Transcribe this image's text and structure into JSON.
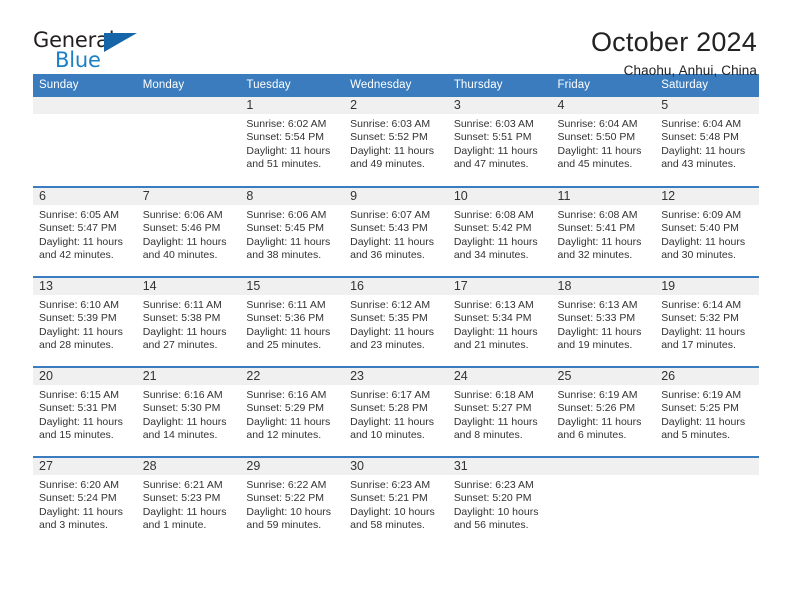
{
  "brand": {
    "name_top": "General",
    "name_bottom": "Blue",
    "triangle_color": "#1565a8",
    "blue_text_color": "#1c7fc4"
  },
  "header": {
    "title": "October 2024",
    "subtitle": "Chaohu, Anhui, China",
    "accent_color": "#3a7cbe",
    "daynum_band_color": "#f0f0f0"
  },
  "weekdays": [
    "Sunday",
    "Monday",
    "Tuesday",
    "Wednesday",
    "Thursday",
    "Friday",
    "Saturday"
  ],
  "weeks": [
    [
      {
        "day": "",
        "lines": []
      },
      {
        "day": "",
        "lines": []
      },
      {
        "day": "1",
        "lines": [
          "Sunrise: 6:02 AM",
          "Sunset: 5:54 PM",
          "Daylight: 11 hours",
          "and 51 minutes."
        ]
      },
      {
        "day": "2",
        "lines": [
          "Sunrise: 6:03 AM",
          "Sunset: 5:52 PM",
          "Daylight: 11 hours",
          "and 49 minutes."
        ]
      },
      {
        "day": "3",
        "lines": [
          "Sunrise: 6:03 AM",
          "Sunset: 5:51 PM",
          "Daylight: 11 hours",
          "and 47 minutes."
        ]
      },
      {
        "day": "4",
        "lines": [
          "Sunrise: 6:04 AM",
          "Sunset: 5:50 PM",
          "Daylight: 11 hours",
          "and 45 minutes."
        ]
      },
      {
        "day": "5",
        "lines": [
          "Sunrise: 6:04 AM",
          "Sunset: 5:48 PM",
          "Daylight: 11 hours",
          "and 43 minutes."
        ]
      }
    ],
    [
      {
        "day": "6",
        "lines": [
          "Sunrise: 6:05 AM",
          "Sunset: 5:47 PM",
          "Daylight: 11 hours",
          "and 42 minutes."
        ]
      },
      {
        "day": "7",
        "lines": [
          "Sunrise: 6:06 AM",
          "Sunset: 5:46 PM",
          "Daylight: 11 hours",
          "and 40 minutes."
        ]
      },
      {
        "day": "8",
        "lines": [
          "Sunrise: 6:06 AM",
          "Sunset: 5:45 PM",
          "Daylight: 11 hours",
          "and 38 minutes."
        ]
      },
      {
        "day": "9",
        "lines": [
          "Sunrise: 6:07 AM",
          "Sunset: 5:43 PM",
          "Daylight: 11 hours",
          "and 36 minutes."
        ]
      },
      {
        "day": "10",
        "lines": [
          "Sunrise: 6:08 AM",
          "Sunset: 5:42 PM",
          "Daylight: 11 hours",
          "and 34 minutes."
        ]
      },
      {
        "day": "11",
        "lines": [
          "Sunrise: 6:08 AM",
          "Sunset: 5:41 PM",
          "Daylight: 11 hours",
          "and 32 minutes."
        ]
      },
      {
        "day": "12",
        "lines": [
          "Sunrise: 6:09 AM",
          "Sunset: 5:40 PM",
          "Daylight: 11 hours",
          "and 30 minutes."
        ]
      }
    ],
    [
      {
        "day": "13",
        "lines": [
          "Sunrise: 6:10 AM",
          "Sunset: 5:39 PM",
          "Daylight: 11 hours",
          "and 28 minutes."
        ]
      },
      {
        "day": "14",
        "lines": [
          "Sunrise: 6:11 AM",
          "Sunset: 5:38 PM",
          "Daylight: 11 hours",
          "and 27 minutes."
        ]
      },
      {
        "day": "15",
        "lines": [
          "Sunrise: 6:11 AM",
          "Sunset: 5:36 PM",
          "Daylight: 11 hours",
          "and 25 minutes."
        ]
      },
      {
        "day": "16",
        "lines": [
          "Sunrise: 6:12 AM",
          "Sunset: 5:35 PM",
          "Daylight: 11 hours",
          "and 23 minutes."
        ]
      },
      {
        "day": "17",
        "lines": [
          "Sunrise: 6:13 AM",
          "Sunset: 5:34 PM",
          "Daylight: 11 hours",
          "and 21 minutes."
        ]
      },
      {
        "day": "18",
        "lines": [
          "Sunrise: 6:13 AM",
          "Sunset: 5:33 PM",
          "Daylight: 11 hours",
          "and 19 minutes."
        ]
      },
      {
        "day": "19",
        "lines": [
          "Sunrise: 6:14 AM",
          "Sunset: 5:32 PM",
          "Daylight: 11 hours",
          "and 17 minutes."
        ]
      }
    ],
    [
      {
        "day": "20",
        "lines": [
          "Sunrise: 6:15 AM",
          "Sunset: 5:31 PM",
          "Daylight: 11 hours",
          "and 15 minutes."
        ]
      },
      {
        "day": "21",
        "lines": [
          "Sunrise: 6:16 AM",
          "Sunset: 5:30 PM",
          "Daylight: 11 hours",
          "and 14 minutes."
        ]
      },
      {
        "day": "22",
        "lines": [
          "Sunrise: 6:16 AM",
          "Sunset: 5:29 PM",
          "Daylight: 11 hours",
          "and 12 minutes."
        ]
      },
      {
        "day": "23",
        "lines": [
          "Sunrise: 6:17 AM",
          "Sunset: 5:28 PM",
          "Daylight: 11 hours",
          "and 10 minutes."
        ]
      },
      {
        "day": "24",
        "lines": [
          "Sunrise: 6:18 AM",
          "Sunset: 5:27 PM",
          "Daylight: 11 hours",
          "and 8 minutes."
        ]
      },
      {
        "day": "25",
        "lines": [
          "Sunrise: 6:19 AM",
          "Sunset: 5:26 PM",
          "Daylight: 11 hours",
          "and 6 minutes."
        ]
      },
      {
        "day": "26",
        "lines": [
          "Sunrise: 6:19 AM",
          "Sunset: 5:25 PM",
          "Daylight: 11 hours",
          "and 5 minutes."
        ]
      }
    ],
    [
      {
        "day": "27",
        "lines": [
          "Sunrise: 6:20 AM",
          "Sunset: 5:24 PM",
          "Daylight: 11 hours",
          "and 3 minutes."
        ]
      },
      {
        "day": "28",
        "lines": [
          "Sunrise: 6:21 AM",
          "Sunset: 5:23 PM",
          "Daylight: 11 hours",
          "and 1 minute."
        ]
      },
      {
        "day": "29",
        "lines": [
          "Sunrise: 6:22 AM",
          "Sunset: 5:22 PM",
          "Daylight: 10 hours",
          "and 59 minutes."
        ]
      },
      {
        "day": "30",
        "lines": [
          "Sunrise: 6:23 AM",
          "Sunset: 5:21 PM",
          "Daylight: 10 hours",
          "and 58 minutes."
        ]
      },
      {
        "day": "31",
        "lines": [
          "Sunrise: 6:23 AM",
          "Sunset: 5:20 PM",
          "Daylight: 10 hours",
          "and 56 minutes."
        ]
      },
      {
        "day": "",
        "lines": []
      },
      {
        "day": "",
        "lines": []
      }
    ]
  ]
}
